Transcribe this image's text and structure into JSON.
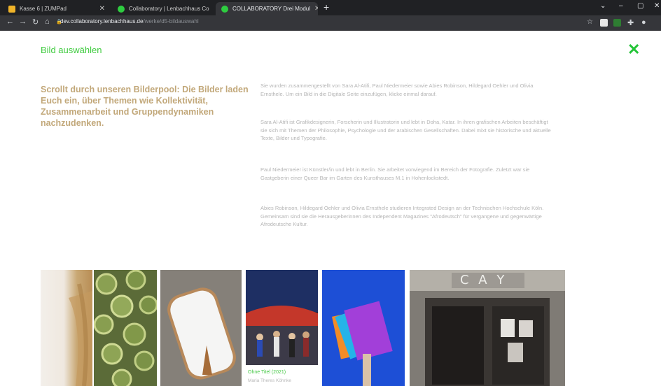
{
  "browser": {
    "tabs": [
      {
        "title": "Kasse 6 | ZUMPad"
      },
      {
        "title": "Collaboratory | Lenbachhaus Co"
      },
      {
        "title": "COLLABORATORY Drei Modul"
      }
    ],
    "address": {
      "host": "dev.collaboratory.lenbachhaus.de",
      "path": "/werke/d5-bildauswahl"
    },
    "colors": {
      "tab_bg": "#202124",
      "toolbar_bg": "#35363a"
    }
  },
  "page": {
    "heading": "Bild auswählen",
    "lead": "Scrollt durch unseren Bilderpool: Die Bilder laden Euch ein, über Themen wie Kollektivität, Zusammenarbeit und Gruppendynamiken nachzudenken.",
    "paragraphs": [
      "Sie wurden zusammengestellt von Sara Al-Atifi, Paul Niedermeier sowie Abies Robinson, Hildegard Oehler und Olivia Ernsthele. Um ein Bild in die Digitale Seite einzufügen, klicke einmal darauf.",
      "Sara Al-Atifi ist Grafikdesignerin, Forscherin und Illustratorin und lebt in Doha, Katar. In ihren grafischen Arbeiten beschäftigt sie sich mit Themen der Philosophie, Psychologie und der arabischen Gesellschaften. Dabei mixt sie historische und aktuelle Texte, Bilder und Typografie.",
      "Paul Niedermeier ist Künstler/in und lebt in Berlin. Sie arbeitet vorwiegend im Bereich der Fotografie. Zuletzt war sie Gastgeberin einer Queer Bar im Garten des Kunsthauses M.1 in Hohenlockstedt.",
      "Abies Robinson, Hildegard Oehler und Olivia Ernsthele studieren Integrated Design an der Technischen Hochschule Köln. Gemeinsam sind sie die Herausgeberinnen des Independent Magazines \"Afrodeutsch\" für vergangene und gegenwärtige Afrodeutsche Kultur."
    ],
    "colors": {
      "heading": "#3fcb3f",
      "lead": "#c2a87a",
      "body": "#b5b5b5",
      "close": "#23c437"
    }
  },
  "gallery": {
    "caption_title": "Ohne Titel (2021)",
    "caption_sub": "Maria Theres Köhnke",
    "sign_text": "C A Y"
  }
}
